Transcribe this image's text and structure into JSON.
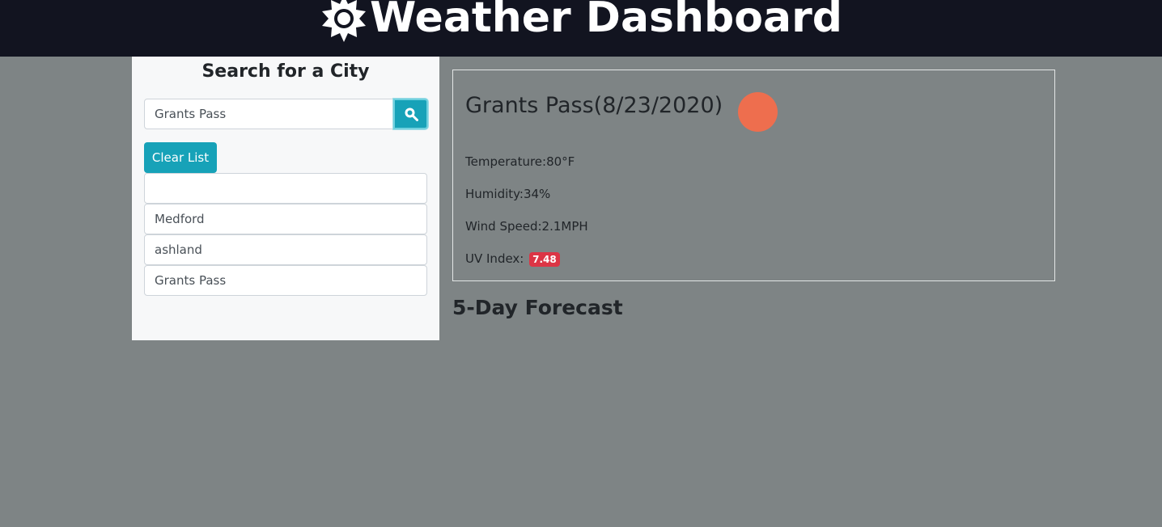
{
  "header": {
    "title": "Weather Dashboard",
    "icon": "sun-icon"
  },
  "sidebar": {
    "title": "Search for a City",
    "search_value": "Grants Pass",
    "search_icon": "search-icon",
    "clear_label": "Clear List",
    "cities": [
      "",
      "Medford",
      "ashland",
      "Grants Pass"
    ]
  },
  "current": {
    "heading": "Grants Pass(8/23/2020)",
    "temperature": "Temperature:80°F",
    "humidity": "Humidity:34%",
    "wind": "Wind Speed:2.1MPH",
    "uv_label": "UV Index:",
    "uv_value": "7.48",
    "icon": "weather-icon"
  },
  "forecast": {
    "title": "5-Day Forecast"
  },
  "colors": {
    "header_bg": "#121420",
    "page_bg": "#7e8485",
    "accent": "#17a2b8",
    "uv_badge": "#dc3545",
    "weather_icon": "#ee6e4e"
  }
}
